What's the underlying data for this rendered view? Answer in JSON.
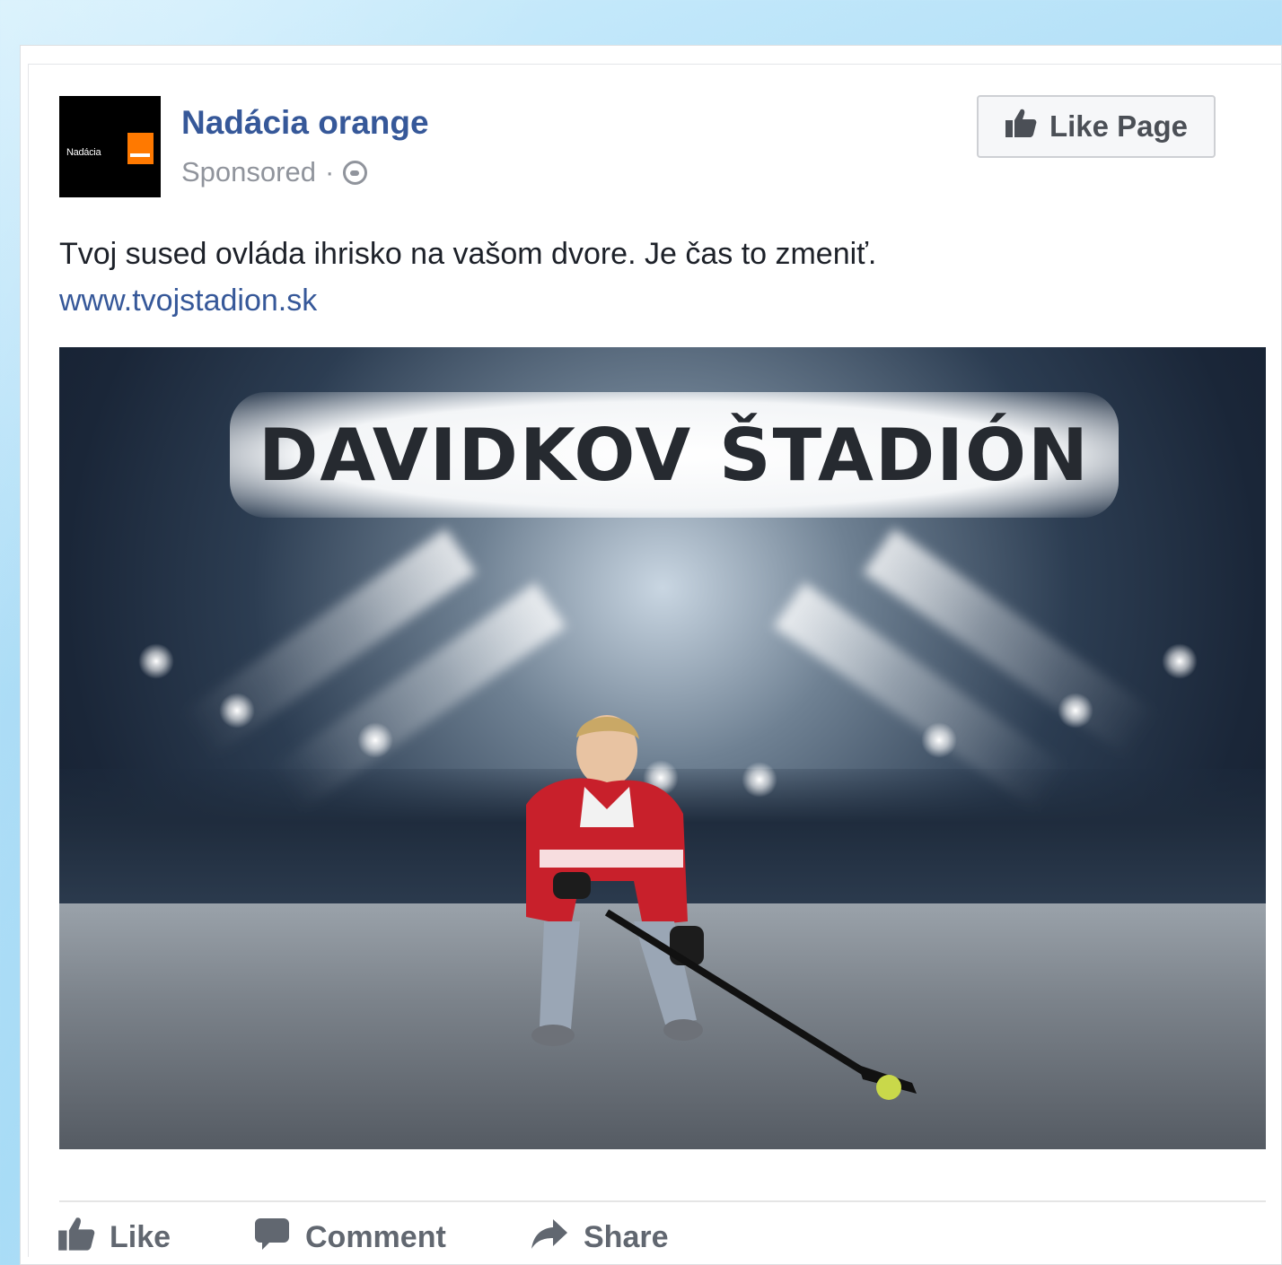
{
  "post": {
    "page_name": "Nadácia orange",
    "sponsored_label": "Sponsored",
    "separator": "·",
    "privacy_icon": "globe-icon",
    "like_page_label": "Like Page",
    "text": "Tvoj sused ovláda ihrisko na vašom dvore. Je čas to zmeniť.",
    "link": "www.tvojstadion.sk",
    "avatar_text": "Nadácia",
    "image_title": "DAVIDKOV ŠTADIÓN"
  },
  "actions": {
    "like": "Like",
    "comment": "Comment",
    "share": "Share"
  },
  "colors": {
    "link_blue": "#365899",
    "meta_gray": "#90949c",
    "action_gray": "#616770",
    "brand_orange": "#ff7900"
  }
}
